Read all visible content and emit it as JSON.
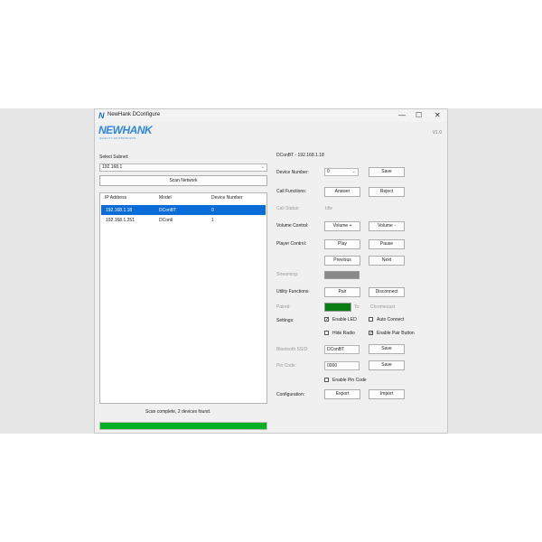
{
  "window": {
    "title": "NewHank DConfigure",
    "logo": "NEWHANK",
    "logo_sub": "QUALITY AV PRODUCTS",
    "version": "V1.0",
    "minimize": "—",
    "maximize": "☐",
    "close": "✕"
  },
  "left": {
    "subnet_label": "Select Subnet:",
    "subnet_value": "192.168.1",
    "scan_button": "Scan Network",
    "columns": [
      "IP Address",
      "Model",
      "Device Number"
    ],
    "devices": [
      {
        "ip": "192.168.1.18",
        "model": "DConBT",
        "number": "0"
      },
      {
        "ip": "192.168.1.251",
        "model": "DConIi",
        "number": "1"
      }
    ],
    "status": "Scan complete, 2 devices found.",
    "progress": 1.0
  },
  "right": {
    "device_header": "DConBT - 192.168.1.18",
    "device_number_label": "Device Number:",
    "device_number_value": "0",
    "save_label": "Save",
    "call_functions_label": "Call Functions:",
    "answer_button": "Answer",
    "reject_button": "Reject",
    "call_status_label": "Call Status:",
    "call_status_value": "Idle",
    "volume_label": "Volume Control:",
    "volume_up": "Volume +",
    "volume_down": "Volume -",
    "player_label": "Player Control:",
    "play": "Play",
    "pause": "Pause",
    "previous": "Previous",
    "next": "Next",
    "streaming_label": "Streaming:",
    "utility_label": "Utility Functions:",
    "pair": "Pair",
    "disconnect": "Disconnect",
    "paired_label": "Paired:",
    "paired_to": "To:",
    "paired_device": "Chromecast",
    "settings_label": "Settings:",
    "enable_led": "Enable LED",
    "auto_connect": "Auto Connect",
    "hide_radio": "Hide Radio",
    "enable_pair_button": "Enable Pair Button",
    "bt_ssid_label": "Bluetooth SSID:",
    "bt_ssid_value": "DConBT",
    "pin_label": "Pin Code:",
    "pin_value": "0000",
    "enable_pin": "Enable Pin Code",
    "config_label": "Configuration:",
    "export": "Export",
    "import": "Import",
    "check_mark": "✓",
    "checks": {
      "enable_led": true,
      "auto_connect": false,
      "hide_radio": false,
      "enable_pair_button": true,
      "enable_pin": false
    }
  },
  "colors": {
    "selection": "#0a6cd6",
    "progress": "#06b025",
    "paired": "#0a7d12",
    "streaming": "#8a8a8a",
    "logo": "#2e86de"
  }
}
